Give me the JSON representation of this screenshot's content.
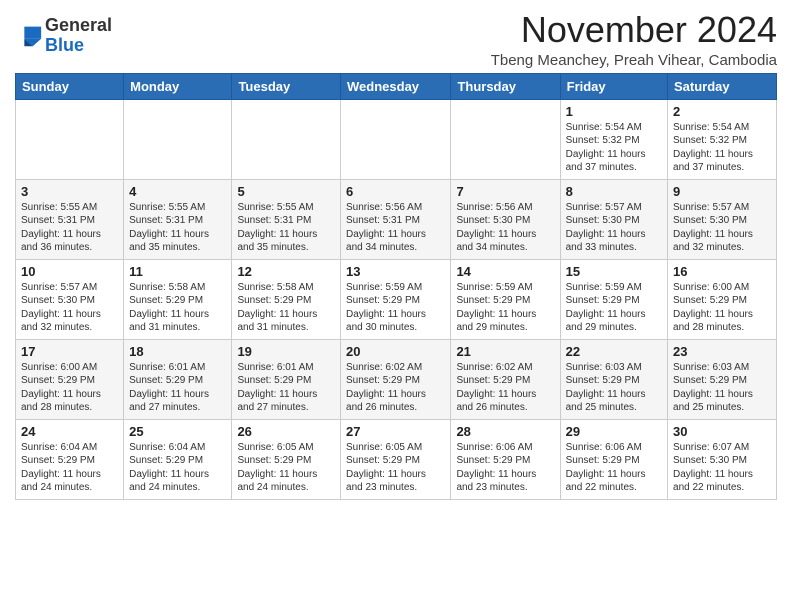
{
  "logo": {
    "general": "General",
    "blue": "Blue"
  },
  "title": "November 2024",
  "location": "Tbeng Meanchey, Preah Vihear, Cambodia",
  "headers": [
    "Sunday",
    "Monday",
    "Tuesday",
    "Wednesday",
    "Thursday",
    "Friday",
    "Saturday"
  ],
  "weeks": [
    [
      {
        "day": "",
        "info": ""
      },
      {
        "day": "",
        "info": ""
      },
      {
        "day": "",
        "info": ""
      },
      {
        "day": "",
        "info": ""
      },
      {
        "day": "",
        "info": ""
      },
      {
        "day": "1",
        "info": "Sunrise: 5:54 AM\nSunset: 5:32 PM\nDaylight: 11 hours\nand 37 minutes."
      },
      {
        "day": "2",
        "info": "Sunrise: 5:54 AM\nSunset: 5:32 PM\nDaylight: 11 hours\nand 37 minutes."
      }
    ],
    [
      {
        "day": "3",
        "info": "Sunrise: 5:55 AM\nSunset: 5:31 PM\nDaylight: 11 hours\nand 36 minutes."
      },
      {
        "day": "4",
        "info": "Sunrise: 5:55 AM\nSunset: 5:31 PM\nDaylight: 11 hours\nand 35 minutes."
      },
      {
        "day": "5",
        "info": "Sunrise: 5:55 AM\nSunset: 5:31 PM\nDaylight: 11 hours\nand 35 minutes."
      },
      {
        "day": "6",
        "info": "Sunrise: 5:56 AM\nSunset: 5:31 PM\nDaylight: 11 hours\nand 34 minutes."
      },
      {
        "day": "7",
        "info": "Sunrise: 5:56 AM\nSunset: 5:30 PM\nDaylight: 11 hours\nand 34 minutes."
      },
      {
        "day": "8",
        "info": "Sunrise: 5:57 AM\nSunset: 5:30 PM\nDaylight: 11 hours\nand 33 minutes."
      },
      {
        "day": "9",
        "info": "Sunrise: 5:57 AM\nSunset: 5:30 PM\nDaylight: 11 hours\nand 32 minutes."
      }
    ],
    [
      {
        "day": "10",
        "info": "Sunrise: 5:57 AM\nSunset: 5:30 PM\nDaylight: 11 hours\nand 32 minutes."
      },
      {
        "day": "11",
        "info": "Sunrise: 5:58 AM\nSunset: 5:29 PM\nDaylight: 11 hours\nand 31 minutes."
      },
      {
        "day": "12",
        "info": "Sunrise: 5:58 AM\nSunset: 5:29 PM\nDaylight: 11 hours\nand 31 minutes."
      },
      {
        "day": "13",
        "info": "Sunrise: 5:59 AM\nSunset: 5:29 PM\nDaylight: 11 hours\nand 30 minutes."
      },
      {
        "day": "14",
        "info": "Sunrise: 5:59 AM\nSunset: 5:29 PM\nDaylight: 11 hours\nand 29 minutes."
      },
      {
        "day": "15",
        "info": "Sunrise: 5:59 AM\nSunset: 5:29 PM\nDaylight: 11 hours\nand 29 minutes."
      },
      {
        "day": "16",
        "info": "Sunrise: 6:00 AM\nSunset: 5:29 PM\nDaylight: 11 hours\nand 28 minutes."
      }
    ],
    [
      {
        "day": "17",
        "info": "Sunrise: 6:00 AM\nSunset: 5:29 PM\nDaylight: 11 hours\nand 28 minutes."
      },
      {
        "day": "18",
        "info": "Sunrise: 6:01 AM\nSunset: 5:29 PM\nDaylight: 11 hours\nand 27 minutes."
      },
      {
        "day": "19",
        "info": "Sunrise: 6:01 AM\nSunset: 5:29 PM\nDaylight: 11 hours\nand 27 minutes."
      },
      {
        "day": "20",
        "info": "Sunrise: 6:02 AM\nSunset: 5:29 PM\nDaylight: 11 hours\nand 26 minutes."
      },
      {
        "day": "21",
        "info": "Sunrise: 6:02 AM\nSunset: 5:29 PM\nDaylight: 11 hours\nand 26 minutes."
      },
      {
        "day": "22",
        "info": "Sunrise: 6:03 AM\nSunset: 5:29 PM\nDaylight: 11 hours\nand 25 minutes."
      },
      {
        "day": "23",
        "info": "Sunrise: 6:03 AM\nSunset: 5:29 PM\nDaylight: 11 hours\nand 25 minutes."
      }
    ],
    [
      {
        "day": "24",
        "info": "Sunrise: 6:04 AM\nSunset: 5:29 PM\nDaylight: 11 hours\nand 24 minutes."
      },
      {
        "day": "25",
        "info": "Sunrise: 6:04 AM\nSunset: 5:29 PM\nDaylight: 11 hours\nand 24 minutes."
      },
      {
        "day": "26",
        "info": "Sunrise: 6:05 AM\nSunset: 5:29 PM\nDaylight: 11 hours\nand 24 minutes."
      },
      {
        "day": "27",
        "info": "Sunrise: 6:05 AM\nSunset: 5:29 PM\nDaylight: 11 hours\nand 23 minutes."
      },
      {
        "day": "28",
        "info": "Sunrise: 6:06 AM\nSunset: 5:29 PM\nDaylight: 11 hours\nand 23 minutes."
      },
      {
        "day": "29",
        "info": "Sunrise: 6:06 AM\nSunset: 5:29 PM\nDaylight: 11 hours\nand 22 minutes."
      },
      {
        "day": "30",
        "info": "Sunrise: 6:07 AM\nSunset: 5:30 PM\nDaylight: 11 hours\nand 22 minutes."
      }
    ]
  ]
}
